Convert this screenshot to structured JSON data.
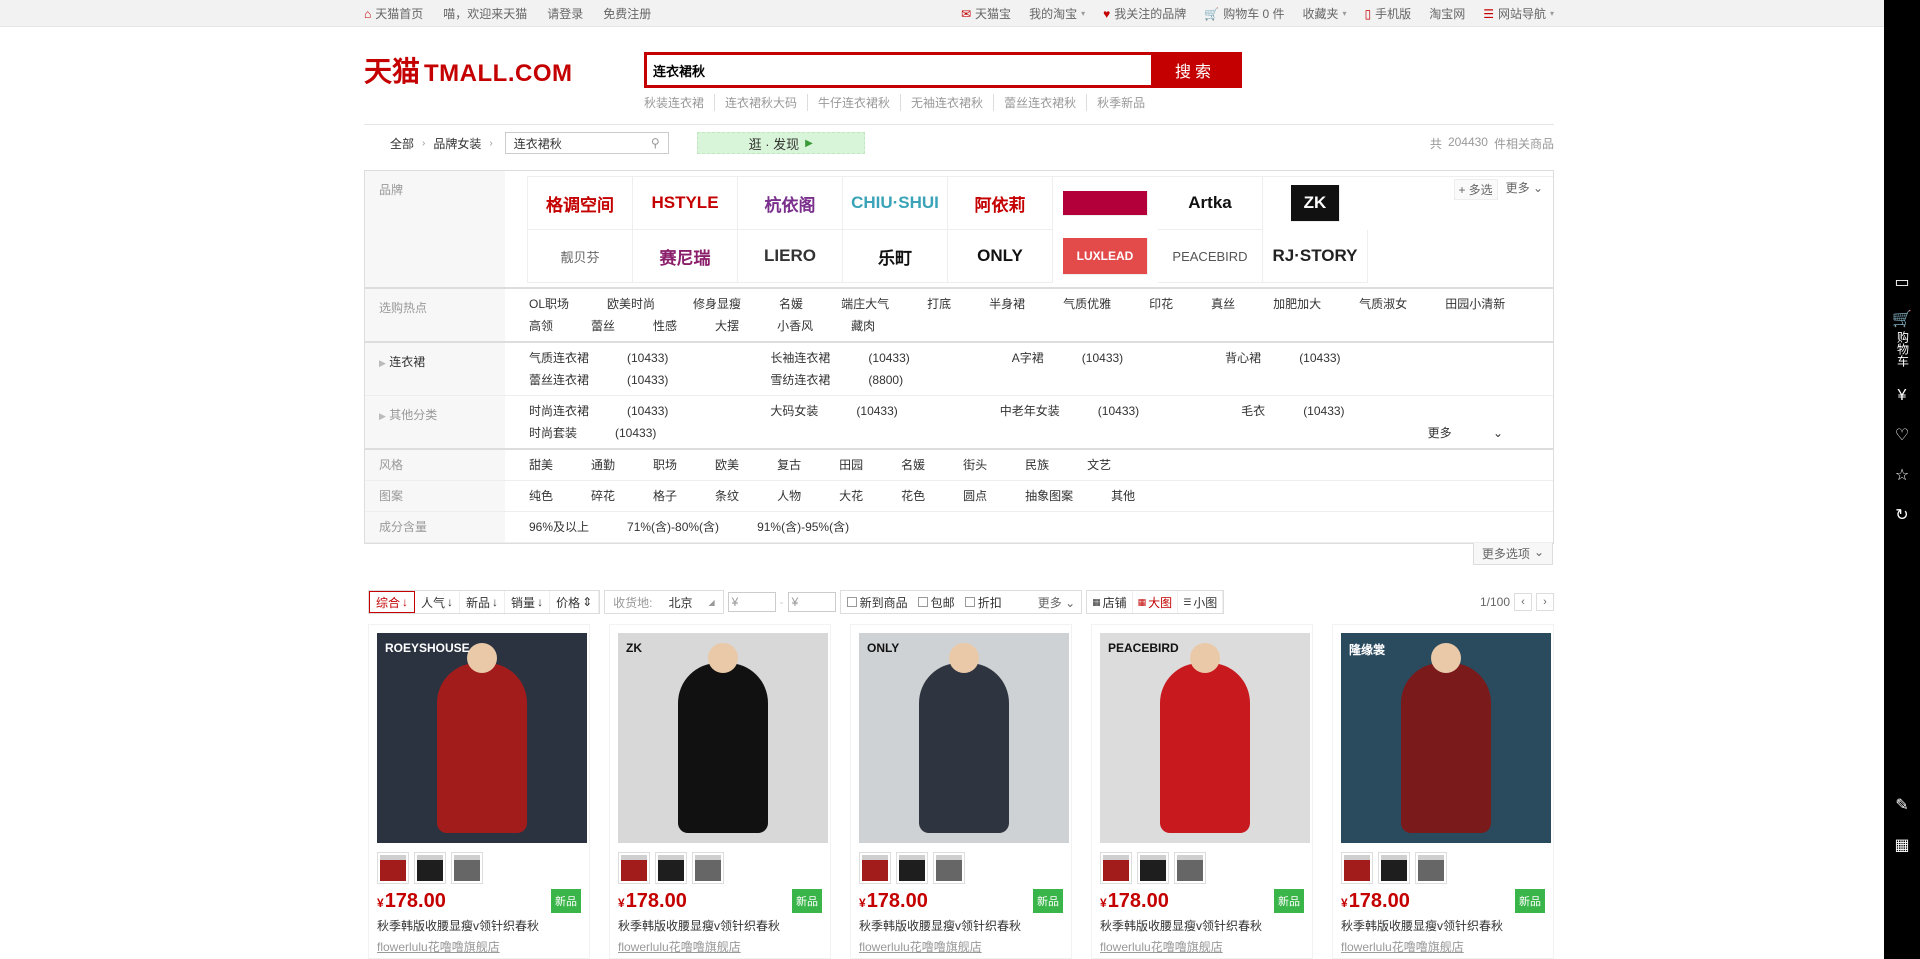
{
  "topbar": {
    "left": [
      "天猫首页",
      "喵，欢迎来天猫",
      "请登录",
      "免费注册"
    ],
    "right": [
      "天猫宝",
      "我的淘宝",
      "我关注的品牌",
      "购物车 0 件",
      "收藏夹",
      "手机版",
      "淘宝网",
      "网站导航"
    ]
  },
  "header": {
    "logo_cn": "天猫",
    "logo_en": "TMALL.COM",
    "search_value": "连衣裙秋",
    "search_button": "搜索",
    "hotwords": [
      "秋装连衣裙",
      "连衣裙秋大码",
      "牛仔连衣裙秋",
      "无袖连衣裙秋",
      "蕾丝连衣裙秋",
      "秋季新品"
    ]
  },
  "crumb": {
    "all": "全部",
    "cat": "品牌女装",
    "query": "连衣裙秋",
    "discover": "逛 · 发现",
    "total_prefix": "共",
    "total_count": "204430",
    "total_suffix": "件相关商品"
  },
  "brands": {
    "label": "品牌",
    "multi": "多选",
    "more": "更多",
    "items": [
      {
        "name": "格调空间",
        "color": "#c40000"
      },
      {
        "name": "HSTYLE",
        "color": "#c40000"
      },
      {
        "name": "杭依阁",
        "color": "#7a2f8c"
      },
      {
        "name": "CHIU·SHUI",
        "color": "#3aa3b8"
      },
      {
        "name": "阿依莉",
        "color": "#c40000"
      },
      {
        "name": "",
        "color": "#b3003b"
      },
      {
        "name": "Artka",
        "color": "#111111"
      },
      {
        "name": "ZK",
        "color": "#ffffff"
      },
      {
        "name": "靓贝芬",
        "color": "#666666"
      },
      {
        "name": "赛尼瑞",
        "color": "#8b1e6b"
      },
      {
        "name": "LIERO",
        "color": "#333333"
      },
      {
        "name": "乐町",
        "color": "#111111"
      },
      {
        "name": "ONLY",
        "color": "#111111"
      },
      {
        "name": "LUXLEAD",
        "color": "#ffffff"
      },
      {
        "name": "PEACEBIRD",
        "color": "#555555"
      },
      {
        "name": "RJ·STORY",
        "color": "#222222"
      }
    ]
  },
  "hot": {
    "label": "选购热点",
    "items": [
      "OL职场",
      "欧美时尚",
      "修身显瘦",
      "名媛",
      "端庄大气",
      "打底",
      "半身裙",
      "气质优雅",
      "印花",
      "真丝",
      "加肥加大",
      "气质淑女",
      "田园小清新",
      "高领",
      "蕾丝",
      "性感",
      "大摆",
      "小香风",
      "藏肉"
    ]
  },
  "dress": {
    "label": "连衣裙",
    "items": [
      {
        "name": "气质连衣裙",
        "count": "(10433)"
      },
      {
        "name": "长袖连衣裙",
        "count": "(10433)"
      },
      {
        "name": "A字裙",
        "count": "(10433)"
      },
      {
        "name": "背心裙",
        "count": "(10433)"
      },
      {
        "name": "蕾丝连衣裙",
        "count": "(10433)"
      },
      {
        "name": "雪纺连衣裙",
        "count": "(8800)"
      }
    ]
  },
  "other": {
    "label": "其他分类",
    "more": "更多",
    "items": [
      {
        "name": "时尚连衣裙",
        "count": "(10433)"
      },
      {
        "name": "大码女装",
        "count": "(10433)"
      },
      {
        "name": "中老年女装",
        "count": "(10433)"
      },
      {
        "name": "毛衣",
        "count": "(10433)"
      },
      {
        "name": "时尚套装",
        "count": "(10433)"
      }
    ]
  },
  "style": {
    "label": "风格",
    "items": [
      "甜美",
      "通勤",
      "职场",
      "欧美",
      "复古",
      "田园",
      "名媛",
      "街头",
      "民族",
      "文艺"
    ]
  },
  "pattern": {
    "label": "图案",
    "items": [
      "纯色",
      "碎花",
      "格子",
      "条纹",
      "人物",
      "大花",
      "花色",
      "圆点",
      "抽象图案",
      "其他"
    ]
  },
  "material": {
    "label": "成分含量",
    "items": [
      "96%及以上",
      "71%(含)-80%(含)",
      "91%(含)-95%(含)"
    ]
  },
  "more_options": "更多选项",
  "sort": {
    "buttons": [
      "综合",
      "人气",
      "新品",
      "销量",
      "价格"
    ],
    "location_label": "收货地:",
    "location": "北京",
    "price_min": "¥",
    "price_max": "¥",
    "checks": [
      "新到商品",
      "包邮",
      "折扣"
    ],
    "more": "更多",
    "views": [
      "店铺",
      "大图",
      "小图"
    ],
    "page": "1/100"
  },
  "products": [
    {
      "brand": "ROEYSHOUSE",
      "price": "178.00",
      "tag": "新品",
      "title": "秋季韩版收腰显瘦v领针织春秋",
      "shop": "flowerlulu花噜噜旗舰店",
      "bg": "#2b3340",
      "dress": "#a31c1c"
    },
    {
      "brand": "ZK",
      "price": "178.00",
      "tag": "新品",
      "title": "秋季韩版收腰显瘦v领针织春秋",
      "shop": "flowerlulu花噜噜旗舰店",
      "bg": "#d8d8d8",
      "dress": "#111111"
    },
    {
      "brand": "ONLY",
      "price": "178.00",
      "tag": "新品",
      "title": "秋季韩版收腰显瘦v领针织春秋",
      "shop": "flowerlulu花噜噜旗舰店",
      "bg": "#cfd2d4",
      "dress": "#2e3440"
    },
    {
      "brand": "PEACEBIRD",
      "price": "178.00",
      "tag": "新品",
      "title": "秋季韩版收腰显瘦v领针织春秋",
      "shop": "flowerlulu花噜噜旗舰店",
      "bg": "#dcdcdc",
      "dress": "#c8191e"
    },
    {
      "brand": "隆缘裳",
      "price": "178.00",
      "tag": "新品",
      "title": "秋季韩版收腰显瘦v领针织春秋",
      "shop": "flowerlulu花噜噜旗舰店",
      "bg": "#2a4a5e",
      "dress": "#7a1a1a"
    }
  ],
  "sidebar": {
    "cart": "购物车"
  },
  "colors": {
    "accent": "#c40000",
    "new": "#3ab54a"
  }
}
